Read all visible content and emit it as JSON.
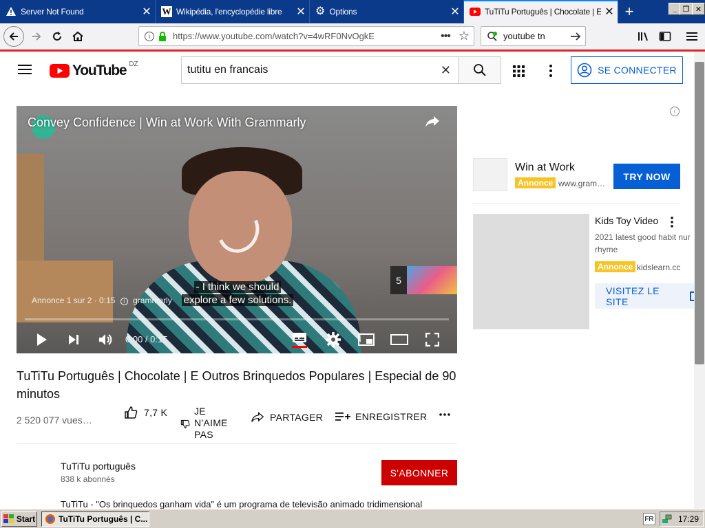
{
  "browser": {
    "tabs": [
      {
        "title": "Server Not Found",
        "icon": "warning-icon"
      },
      {
        "title": "Wikipédia, l'encyclopédie libre",
        "icon": "wikipedia-icon"
      },
      {
        "title": "Options",
        "icon": "gear-icon"
      },
      {
        "title": "TuTiTu Português | Chocolate | E O",
        "icon": "youtube-icon"
      }
    ],
    "url": "https://www.youtube.com/watch?v=4wRF0NvOgkE",
    "search_value": "youtube tn"
  },
  "youtube": {
    "logo_text": "YouTube",
    "country": "DZ",
    "search_value": "tutitu en francais",
    "signin_label": "SE CONNECTER"
  },
  "player": {
    "overlay_title": "Convey Confidence | Win at Work With Grammarly",
    "caption_line1": "- I think we should",
    "caption_line2": "explore a few solutions.",
    "ad_info": "Annonce 1 sur 2 · 0:15",
    "ad_advertiser": "grammarly",
    "skip_count": "5",
    "time": "0:00 / 0:15"
  },
  "video": {
    "title": "TuTiTu Português | Chocolate | E Outros Brinquedos Populares | Especial de 90 minutos",
    "views": "2 520 077 vues…",
    "likes": "7,7 K",
    "dislike_line1": "JE",
    "dislike_line2": "N'AIME",
    "dislike_line3": "PAS",
    "share_label": "PARTAGER",
    "save_label": "ENREGISTRER",
    "channel_name": "TuTiTu português",
    "subscribers": "838 k abonnés",
    "subscribe_label": "S'ABONNER",
    "description": "TuTiTu - \"Os brinquedos ganham vida\" é um programa de televisão animado tridimensional"
  },
  "sidebar": {
    "ad_title": "Win at Work",
    "ad_badge": "Annonce",
    "ad_domain": "www.gram…",
    "try_now_label": "TRY NOW",
    "related_title": "Kids Toy Video",
    "related_desc": "2021 latest good habit nur rhyme",
    "related_badge": "Annonce",
    "related_domain": "kidslearn.cc",
    "visit_label": "VISITEZ LE SITE"
  },
  "taskbar": {
    "start_label": "Start",
    "task_label": "TuTiTu Português | C...",
    "lang": "FR",
    "clock": "17:29"
  },
  "colors": {
    "yt_red": "#ff0000",
    "subscribe_red": "#cc0000",
    "link_blue": "#065fd4",
    "ad_yellow": "#f7c325",
    "tabstrip_blue": "#0b3a8a"
  }
}
